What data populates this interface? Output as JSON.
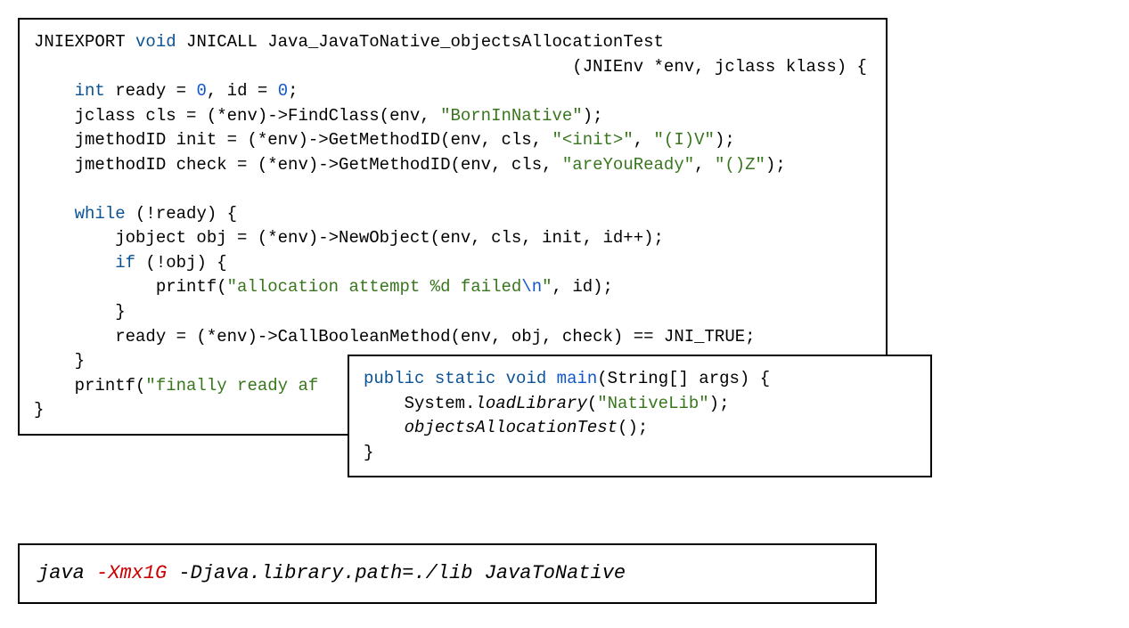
{
  "c_code": {
    "l1a": "JNIEXPORT ",
    "l1b": "void",
    "l1c": " JNICALL Java_JavaToNative_objectsAllocationTest",
    "l2": "                                                     (JNIEnv *env, jclass klass) {",
    "l3a": "    ",
    "l3b": "int",
    "l3c": " ready = ",
    "l3d": "0",
    "l3e": ", id = ",
    "l3f": "0",
    "l3g": ";",
    "l4a": "    jclass cls = (*env)->FindClass(env, ",
    "l4b": "\"BornInNative\"",
    "l4c": ");",
    "l5a": "    jmethodID init = (*env)->GetMethodID(env, cls, ",
    "l5b": "\"<init>\"",
    "l5c": ", ",
    "l5d": "\"(I)V\"",
    "l5e": ");",
    "l6a": "    jmethodID check = (*env)->GetMethodID(env, cls, ",
    "l6b": "\"areYouReady\"",
    "l6c": ", ",
    "l6d": "\"()Z\"",
    "l6e": ");",
    "blank": "",
    "l7a": "    ",
    "l7b": "while",
    "l7c": " (!ready) {",
    "l8a": "        jobject obj = (*env)->NewObject(env, cls, init, id++);",
    "l9a": "        ",
    "l9b": "if",
    "l9c": " (!obj) {",
    "l10a": "            printf(",
    "l10b": "\"allocation attempt %d failed",
    "l10c": "\\n",
    "l10d": "\"",
    "l10e": ", id);",
    "l11": "        }",
    "l12": "        ready = (*env)->CallBooleanMethod(env, obj, check) == JNI_TRUE;",
    "l13": "    }",
    "l14a": "    printf(",
    "l14b": "\"finally ready af",
    "l15": "}"
  },
  "java_code": {
    "l1a": "public",
    "l1b": " ",
    "l1c": "static",
    "l1d": " ",
    "l1e": "void",
    "l1f": " ",
    "l1g": "main",
    "l1h": "(String[] args) {",
    "l2a": "    System.",
    "l2b": "loadLibrary",
    "l2c": "(",
    "l2d": "\"NativeLib\"",
    "l2e": ");",
    "l3a": "    ",
    "l3b": "objectsAllocationTest",
    "l3c": "();",
    "l4": "}"
  },
  "cmd": {
    "p1": "java ",
    "p2": "-Xmx1G",
    "p3": " -Djava.library.path=./lib JavaToNative"
  }
}
